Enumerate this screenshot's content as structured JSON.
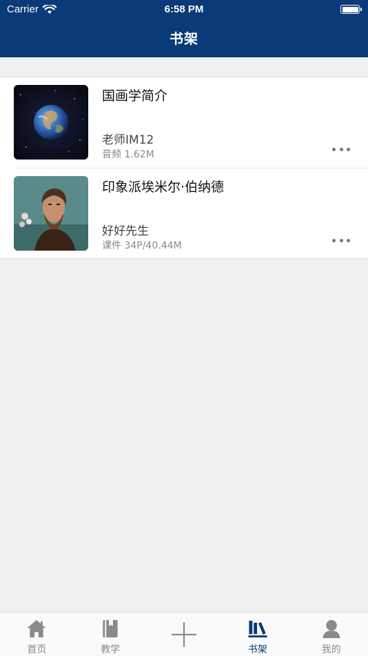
{
  "status_bar": {
    "carrier": "Carrier",
    "time": "6:58 PM"
  },
  "header": {
    "title": "书架"
  },
  "items": [
    {
      "title": "国画学简介",
      "author": "老师IM12",
      "meta": "音频 1.62M",
      "thumb_icon": "earth-image"
    },
    {
      "title": "印象派埃米尔·伯纳德",
      "author": "好好先生",
      "meta": "课件 34P/40.44M",
      "thumb_icon": "portrait-painting-image"
    }
  ],
  "tabs": [
    {
      "label": "首页",
      "icon": "home-icon"
    },
    {
      "label": "教学",
      "icon": "book-icon"
    },
    {
      "label": "",
      "icon": "plus-icon"
    },
    {
      "label": "书架",
      "icon": "bookshelf-icon",
      "active": true
    },
    {
      "label": "我的",
      "icon": "user-icon"
    }
  ],
  "colors": {
    "primary": "#0b3a78",
    "inactive": "#8a8a8a",
    "background": "#f0f0f0"
  }
}
